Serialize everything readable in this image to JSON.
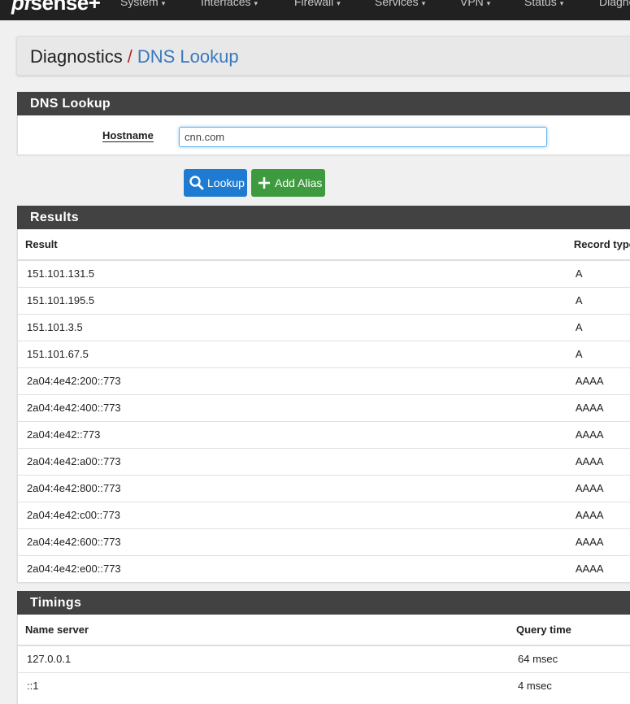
{
  "navbar": {
    "brand_prefix": "pf",
    "brand_suffix": "sense+",
    "items": [
      {
        "label": "System"
      },
      {
        "label": "Interfaces"
      },
      {
        "label": "Firewall"
      },
      {
        "label": "Services"
      },
      {
        "label": "VPN"
      },
      {
        "label": "Status"
      },
      {
        "label": "Diagnostics"
      }
    ]
  },
  "breadcrumb": {
    "parent": "Diagnostics",
    "separator": "/",
    "current": "DNS Lookup"
  },
  "lookup_panel": {
    "title": "DNS Lookup",
    "hostname_label": "Hostname",
    "hostname_value": "cnn.com"
  },
  "buttons": {
    "lookup_label": "Lookup",
    "add_alias_label": "Add Alias"
  },
  "results": {
    "title": "Results",
    "columns": [
      "Result",
      "Record type"
    ],
    "rows": [
      [
        "151.101.131.5",
        "A"
      ],
      [
        "151.101.195.5",
        "A"
      ],
      [
        "151.101.3.5",
        "A"
      ],
      [
        "151.101.67.5",
        "A"
      ],
      [
        "2a04:4e42:200::773",
        "AAAA"
      ],
      [
        "2a04:4e42:400::773",
        "AAAA"
      ],
      [
        "2a04:4e42::773",
        "AAAA"
      ],
      [
        "2a04:4e42:a00::773",
        "AAAA"
      ],
      [
        "2a04:4e42:800::773",
        "AAAA"
      ],
      [
        "2a04:4e42:c00::773",
        "AAAA"
      ],
      [
        "2a04:4e42:600::773",
        "AAAA"
      ],
      [
        "2a04:4e42:e00::773",
        "AAAA"
      ]
    ]
  },
  "timings": {
    "title": "Timings",
    "columns": [
      "Name server",
      "Query time"
    ],
    "rows": [
      [
        "127.0.0.1",
        "64 msec"
      ],
      [
        "::1",
        "4 msec"
      ]
    ]
  },
  "colors": {
    "navbar": "#212121",
    "panel_header": "#424242",
    "breadcrumb_separator": "#b32a2a",
    "breadcrumb_current": "#3a78c0",
    "lookup_button": "#1e7bd1",
    "add_alias_button": "#3e9a3e"
  },
  "icons": {
    "lookup_button": "search-icon",
    "add_alias_button": "plus-icon",
    "nav_caret": "chevron-down-icon"
  }
}
